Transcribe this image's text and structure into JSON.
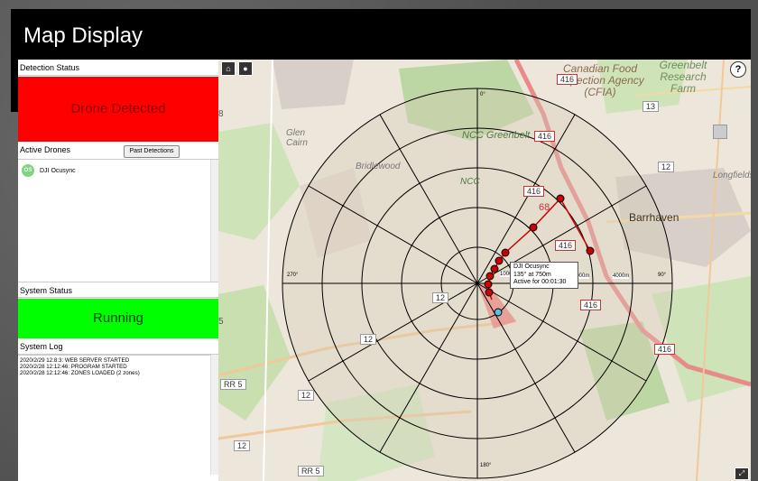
{
  "window": {
    "title": "Map Display"
  },
  "detection": {
    "header": "Detection Status",
    "status_text": "Drone Detected",
    "status_color": "#ff0000"
  },
  "active_drones": {
    "header": "Active Drones",
    "past_button": "Past Detections",
    "items": [
      {
        "badge": "OS",
        "name": "DJI Ocusync"
      }
    ]
  },
  "system_status": {
    "header": "System Status",
    "status_text": "Running",
    "status_color": "#00ff00"
  },
  "system_log": {
    "header": "System Log",
    "lines": [
      "2020/2/29 12:8:3: WEB SERVER STARTED",
      "2020/2/28 12:12:46: PROGRAM STARTED",
      "2020/2/28 12:12:46: ZONES LOADED (2 zones)"
    ]
  },
  "map": {
    "labels": [
      "Canadian Food Inspection Agency (CFIA)",
      "Greenbelt Research Farm",
      "NCC Greenbelt",
      "Glen Cairn",
      "Bridlewood",
      "Barrhaven",
      "Longfields",
      "NCC"
    ],
    "road_labels": [
      "416",
      "416",
      "416",
      "416",
      "416",
      "416",
      "13",
      "12",
      "12",
      "12",
      "12",
      "12",
      "RR 5",
      "RR 5",
      "68",
      "8",
      "5"
    ],
    "radar": {
      "bearings": [
        "0°",
        "90°",
        "180°",
        "270°"
      ],
      "range_labels": [
        "1000",
        "3000m",
        "4000m"
      ],
      "tooltip": {
        "name": "DJI Ocusync",
        "bearing": "135° at 750m",
        "active": "Active for 00:01:30"
      }
    }
  },
  "icons": {
    "home": "home-icon",
    "location": "location-icon",
    "help": "help-icon",
    "fullscreen": "fullscreen-icon"
  },
  "colors": {
    "detected": "#ff0000",
    "running": "#00ff00",
    "track": "#cc0000"
  }
}
